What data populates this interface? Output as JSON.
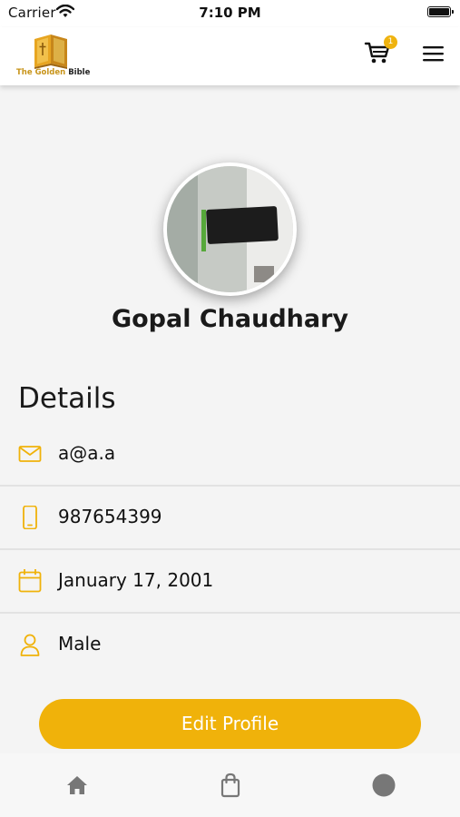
{
  "status_bar": {
    "carrier": "Carrier",
    "time": "7:10 PM"
  },
  "header": {
    "logo_text_golden": "The Golden",
    "logo_text_bible": "Bible",
    "cart_badge_count": "1",
    "icons": {
      "cart": "cart-icon",
      "menu": "hamburger-menu-icon"
    }
  },
  "profile": {
    "name": "Gopal Chaudhary"
  },
  "details": {
    "title": "Details",
    "items": [
      {
        "icon": "email-icon",
        "value": "a@a.a"
      },
      {
        "icon": "phone-icon",
        "value": "987654399"
      },
      {
        "icon": "calendar-icon",
        "value": "January 17, 2001"
      },
      {
        "icon": "person-icon",
        "value": "Male"
      }
    ]
  },
  "edit_button": {
    "label": "Edit Profile"
  },
  "tab_bar": {
    "items": [
      {
        "icon": "home-icon"
      },
      {
        "icon": "shopping-bag-icon"
      },
      {
        "icon": "profile-circle-icon"
      }
    ]
  },
  "colors": {
    "accent": "#F0B20A",
    "background": "#F4F4F4",
    "tab_icon": "#777777"
  }
}
